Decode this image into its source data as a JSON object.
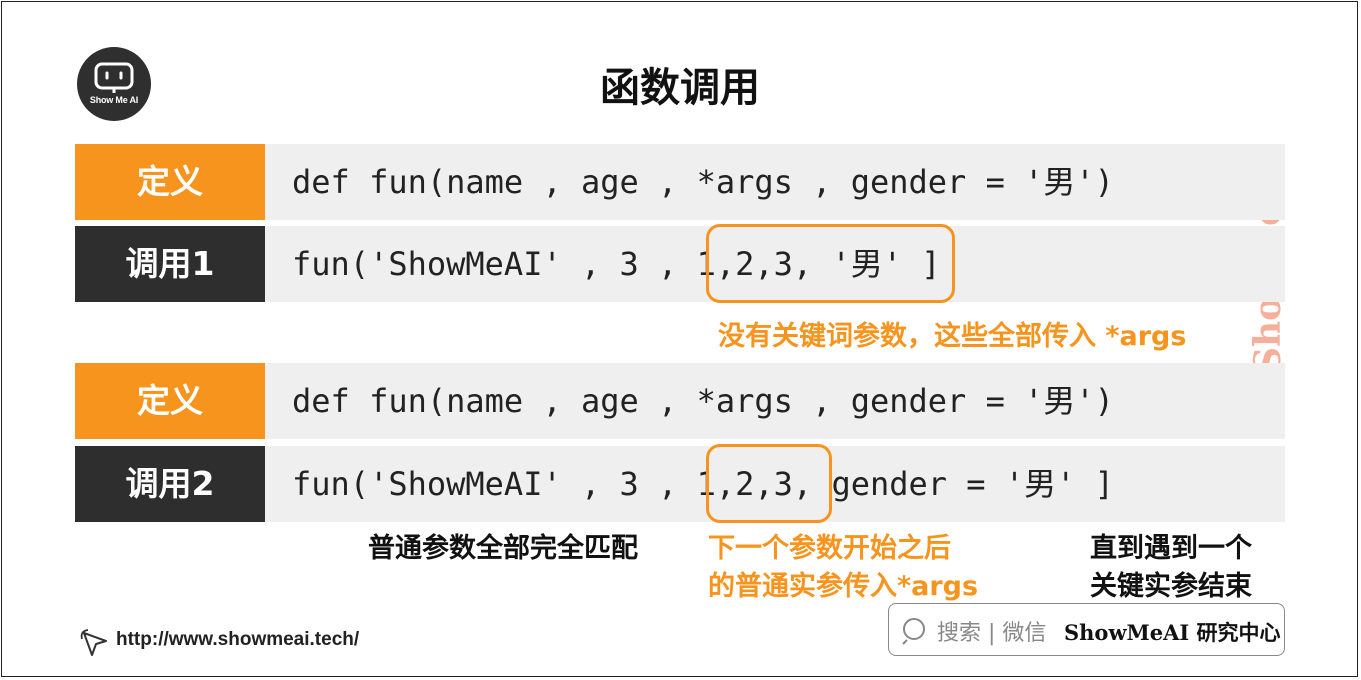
{
  "logo": {
    "text": "Show Me AI"
  },
  "title": "函数调用",
  "rows": [
    {
      "label": "定义",
      "code": "def fun(name , age , *args , gender = '男')"
    },
    {
      "label": "调用1",
      "code": "fun('ShowMeAI' , 3 , 1,2,3, '男' ]"
    },
    {
      "label": "定义",
      "code": "def fun(name , age , *args , gender = '男')"
    },
    {
      "label": "调用2",
      "code": "fun('ShowMeAI' , 3 , 1,2,3, gender = '男' ]"
    }
  ],
  "notes": {
    "call1_note": "没有关键词参数，这些全部传入 *args",
    "positional_match": "普通参数全部完全匹配",
    "after_first_line1": "下一个参数开始之后",
    "after_first_line2": "的普通实参传入*args",
    "until_line1": "直到遇到一个",
    "until_line2": "关键实参结束"
  },
  "watermark": "ShowMeAI",
  "footer": {
    "url": "http://www.showmeai.tech/",
    "search_hint": "搜索 | 微信",
    "brand": "ShowMeAI 研究中心"
  },
  "colors": {
    "accent": "#f7941d",
    "dark": "#2e2e2e",
    "row_bg": "#efefef"
  }
}
